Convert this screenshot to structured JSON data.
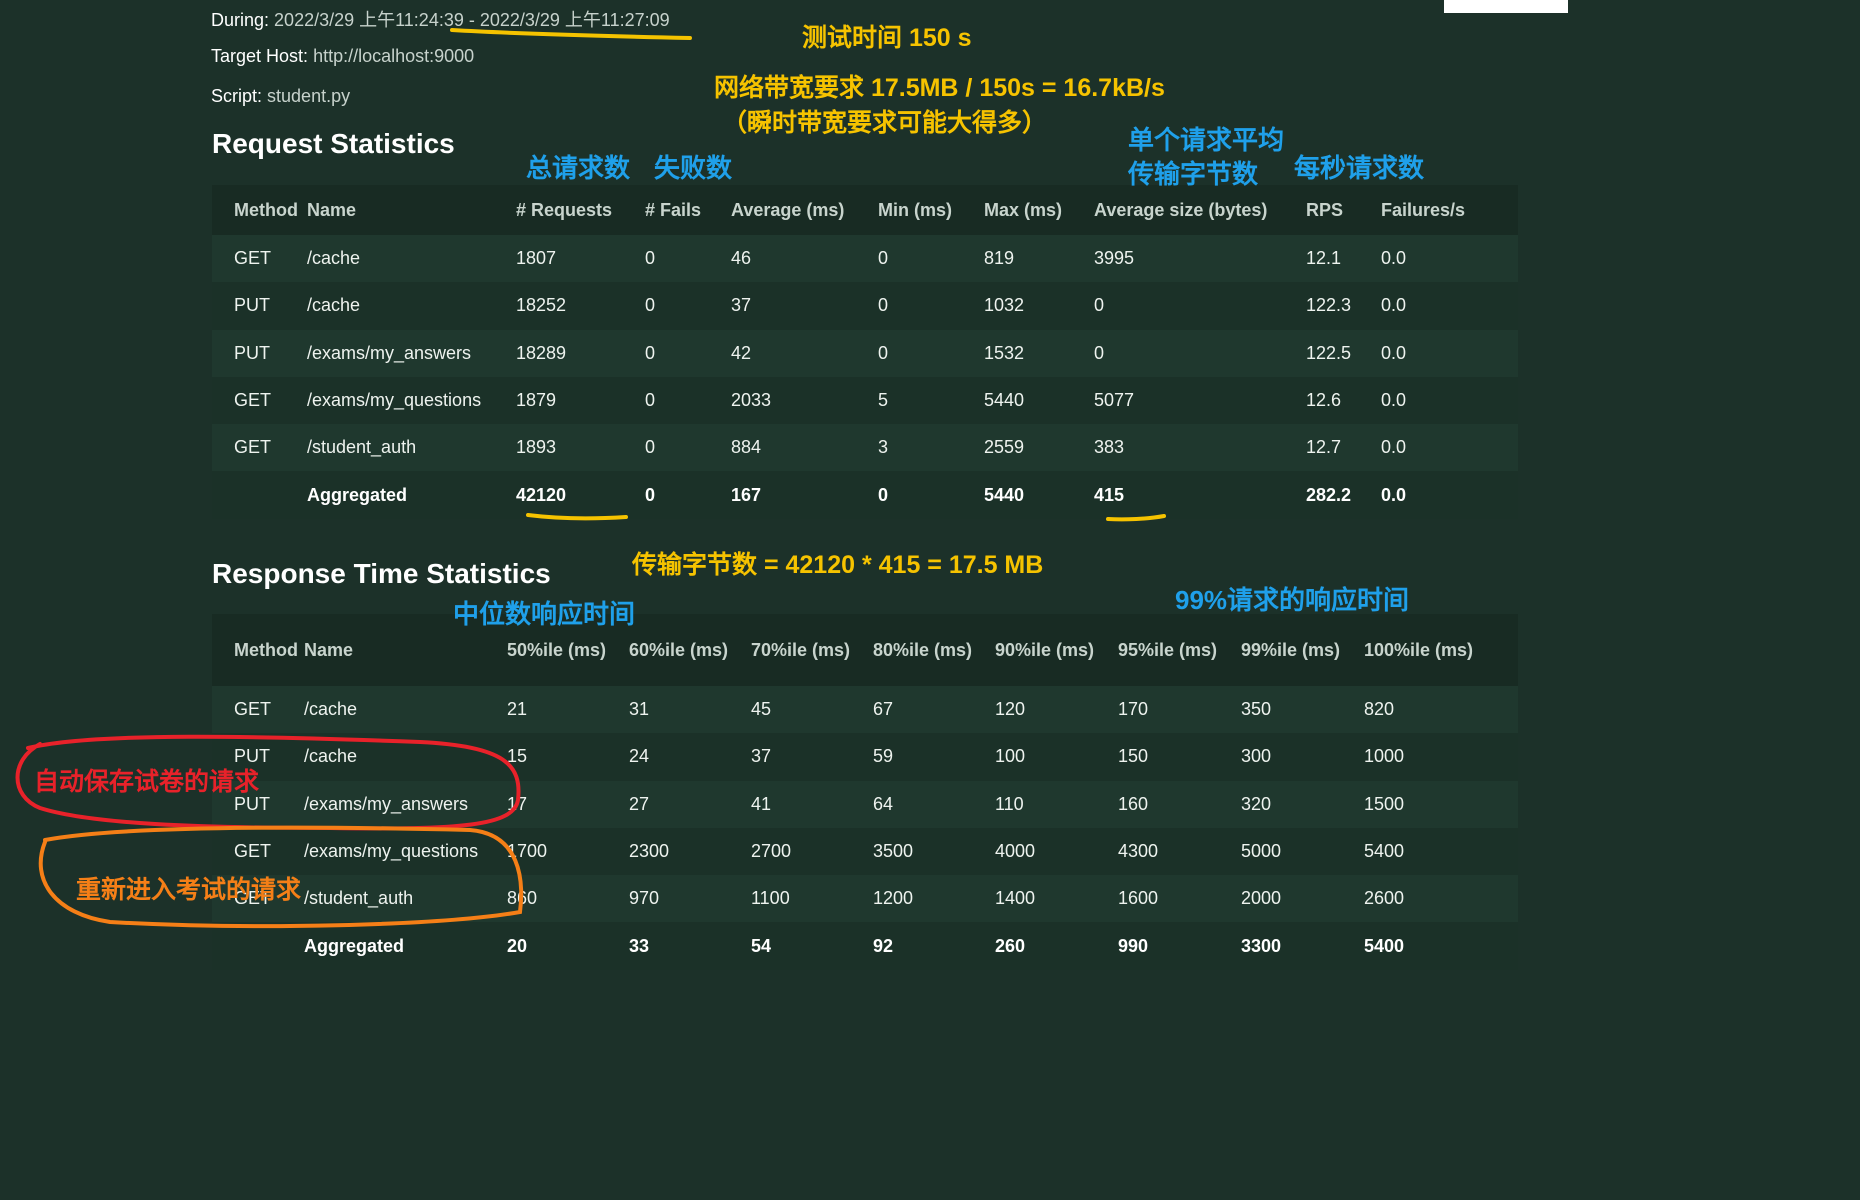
{
  "info": {
    "during_label": "During:",
    "during_value": "2022/3/29 上午11:24:39 - 2022/3/29 上午11:27:09",
    "host_label": "Target Host:",
    "host_value": "http://localhost:9000",
    "script_label": "Script:",
    "script_value": "student.py"
  },
  "request_stats": {
    "title": "Request Statistics",
    "columns": [
      "Method",
      "Name",
      "# Requests",
      "# Fails",
      "Average (ms)",
      "Min (ms)",
      "Max (ms)",
      "Average size (bytes)",
      "RPS",
      "Failures/s"
    ],
    "rows": [
      {
        "method": "GET",
        "name": "/cache",
        "requests": "1807",
        "fails": "0",
        "avg": "46",
        "min": "0",
        "max": "819",
        "size": "3995",
        "rps": "12.1",
        "fps": "0.0"
      },
      {
        "method": "PUT",
        "name": "/cache",
        "requests": "18252",
        "fails": "0",
        "avg": "37",
        "min": "0",
        "max": "1032",
        "size": "0",
        "rps": "122.3",
        "fps": "0.0"
      },
      {
        "method": "PUT",
        "name": "/exams/my_answers",
        "requests": "18289",
        "fails": "0",
        "avg": "42",
        "min": "0",
        "max": "1532",
        "size": "0",
        "rps": "122.5",
        "fps": "0.0"
      },
      {
        "method": "GET",
        "name": "/exams/my_questions",
        "requests": "1879",
        "fails": "0",
        "avg": "2033",
        "min": "5",
        "max": "5440",
        "size": "5077",
        "rps": "12.6",
        "fps": "0.0"
      },
      {
        "method": "GET",
        "name": "/student_auth",
        "requests": "1893",
        "fails": "0",
        "avg": "884",
        "min": "3",
        "max": "2559",
        "size": "383",
        "rps": "12.7",
        "fps": "0.0"
      }
    ],
    "aggregated": {
      "method": "",
      "name": "Aggregated",
      "requests": "42120",
      "fails": "0",
      "avg": "167",
      "min": "0",
      "max": "5440",
      "size": "415",
      "rps": "282.2",
      "fps": "0.0"
    }
  },
  "response_stats": {
    "title": "Response Time Statistics",
    "columns": [
      "Method",
      "Name",
      "50%ile (ms)",
      "60%ile (ms)",
      "70%ile (ms)",
      "80%ile (ms)",
      "90%ile (ms)",
      "95%ile (ms)",
      "99%ile (ms)",
      "100%ile (ms)"
    ],
    "rows": [
      {
        "method": "GET",
        "name": "/cache",
        "values": [
          "21",
          "31",
          "45",
          "67",
          "120",
          "170",
          "350",
          "820"
        ]
      },
      {
        "method": "PUT",
        "name": "/cache",
        "values": [
          "15",
          "24",
          "37",
          "59",
          "100",
          "150",
          "300",
          "1000"
        ]
      },
      {
        "method": "PUT",
        "name": "/exams/my_answers",
        "values": [
          "17",
          "27",
          "41",
          "64",
          "110",
          "160",
          "320",
          "1500"
        ]
      },
      {
        "method": "GET",
        "name": "/exams/my_questions",
        "values": [
          "1700",
          "2300",
          "2700",
          "3500",
          "4000",
          "4300",
          "5000",
          "5400"
        ]
      },
      {
        "method": "GET",
        "name": "/student_auth",
        "values": [
          "860",
          "970",
          "1100",
          "1200",
          "1400",
          "1600",
          "2000",
          "2600"
        ]
      }
    ],
    "aggregated": {
      "method": "",
      "name": "Aggregated",
      "values": [
        "20",
        "33",
        "54",
        "92",
        "260",
        "990",
        "3300",
        "5400"
      ]
    }
  },
  "annotations": {
    "test_time": "测试时间 150 s",
    "bandwidth": "网络带宽要求 17.5MB / 150s = 16.7kB/s",
    "bandwidth_note": "（瞬时带宽要求可能大得多）",
    "total_requests": "总请求数",
    "fail_count": "失败数",
    "avg_bytes_line1": "单个请求平均",
    "avg_bytes_line2": "传输字节数",
    "rps": "每秒请求数",
    "transfer_bytes": "传输字节数 = 42120 * 415 = 17.5 MB",
    "median_time": "中位数响应时间",
    "p99_time": "99%请求的响应时间",
    "autosave": "自动保存试卷的请求",
    "reenter": "重新进入考试的请求"
  },
  "colors": {
    "background": "#1c3129",
    "annotation_yellow": "#f6c300",
    "annotation_blue": "#1fa0ea",
    "annotation_red": "#e8222a",
    "annotation_orange": "#f57f17"
  }
}
